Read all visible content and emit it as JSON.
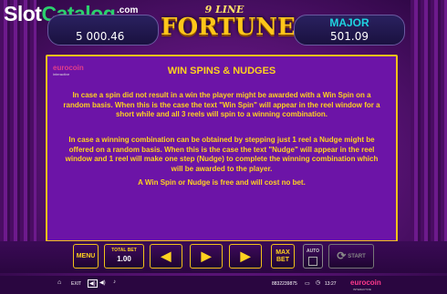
{
  "watermark": {
    "part_a": "Slot",
    "part_b": "Catalog",
    "suffix": ".com"
  },
  "game_logo": {
    "top": "9 LINE",
    "main": "FORTUNE"
  },
  "jackpots": {
    "left_value": "5 000.46",
    "right_title": "MAJOR",
    "right_value": "501.09"
  },
  "panel": {
    "brand": "eurocoin",
    "brand_sub": "interactive",
    "title": "WIN SPINS & NUDGES",
    "paragraphs": [
      "In case a spin did not result in a win the player might be awarded with a Win Spin on a random basis. When this is the case the text \"Win Spin\" will appear in the reel window for a short while and all 3 reels will spin to a winning combination.",
      "In case a winning combination can be obtained by stepping just 1 reel a Nudge might be offered on a random basis. When this is the case the text \"Nudge\" will appear in the reel window and 1 reel will make one step (Nudge) to complete the winning combination which will be awarded to the player.",
      "A Win Spin or Nudge is free and will cost no bet."
    ]
  },
  "controls": {
    "menu_label": "MENU",
    "total_bet_label": "TOTAL BET",
    "total_bet_value": "1.00",
    "max_bet_label": "MAX BET",
    "auto_label": "AUTO",
    "start_label": "START"
  },
  "status": {
    "exit_label": "EXIT",
    "session_id": "8832239875",
    "time": "13:27",
    "brand": "eurocoin",
    "brand_sub": "INTERACTIVE"
  },
  "icons": {
    "home": "home-icon",
    "sound": "speaker-icon",
    "screen": "screen-icon",
    "clock": "clock-icon",
    "prev": "arrow-left-icon",
    "play": "play-icon",
    "next": "arrow-right-icon",
    "spin": "spin-icon"
  },
  "colors": {
    "panel_bg": "#6c14a7",
    "accent_gold": "#f2c21a",
    "text_yellow": "#ffd21f",
    "jackpot_cyan": "#1fd3e0"
  }
}
